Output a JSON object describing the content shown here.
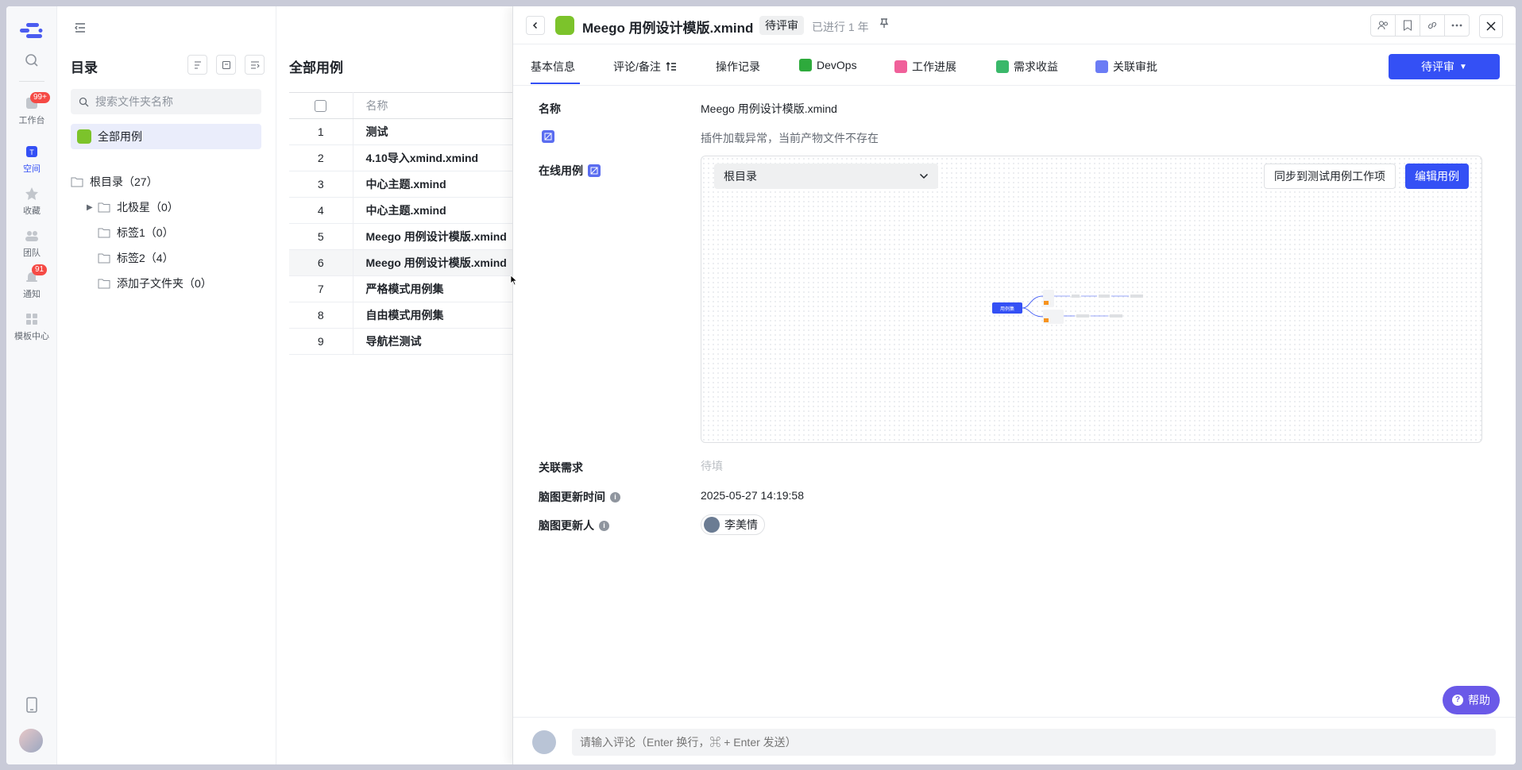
{
  "rail": {
    "items": [
      {
        "icon": "search-icon",
        "label": ""
      },
      {
        "icon": "workbench-icon",
        "label": "工作台",
        "badge": "99+"
      },
      {
        "icon": "space-icon",
        "label": "空间",
        "active": true
      },
      {
        "icon": "star-icon",
        "label": "收藏"
      },
      {
        "icon": "team-icon",
        "label": "团队"
      },
      {
        "icon": "bell-icon",
        "label": "通知",
        "badge": "91"
      },
      {
        "icon": "template-icon",
        "label": "模板中心"
      }
    ]
  },
  "directory": {
    "title": "目录",
    "search_placeholder": "搜索文件夹名称",
    "all_cases": "全部用例",
    "tree": [
      {
        "label": "根目录（27）"
      },
      {
        "label": "北极星（0）"
      },
      {
        "label": "标签1（0）"
      },
      {
        "label": "标签2（4）"
      },
      {
        "label": "添加子文件夹（0）"
      }
    ]
  },
  "list": {
    "title": "全部用例",
    "header_name": "名称",
    "rows": [
      {
        "num": "1",
        "name": "测试"
      },
      {
        "num": "2",
        "name": "4.10导入xmind.xmind"
      },
      {
        "num": "3",
        "name": "中心主题.xmind"
      },
      {
        "num": "4",
        "name": "中心主题.xmind"
      },
      {
        "num": "5",
        "name": "Meego 用例设计模版.xmind"
      },
      {
        "num": "6",
        "name": "Meego 用例设计模版.xmind"
      },
      {
        "num": "7",
        "name": "严格模式用例集"
      },
      {
        "num": "8",
        "name": "自由模式用例集"
      },
      {
        "num": "9",
        "name": "导航栏测试"
      }
    ]
  },
  "detail": {
    "title": "Meego 用例设计模版.xmind",
    "status": "待评审",
    "elapsed": "已进行 1 年",
    "tabs": [
      "基本信息",
      "评论/备注",
      "操作记录",
      "DevOps",
      "工作进展",
      "需求收益",
      "关联审批"
    ],
    "status_button": "待评审",
    "fields": {
      "name_label": "名称",
      "name_value": "Meego 用例设计模版.xmind",
      "plugin_error": "插件加载异常，当前产物文件不存在",
      "online_case_label": "在线用例",
      "root_select": "根目录",
      "sync_button": "同步到测试用例工作项",
      "edit_button": "编辑用例",
      "mindmap_root": "用例集",
      "related_req_label": "关联需求",
      "related_req_value": "待填",
      "mindmap_updated_label": "脑图更新时间",
      "mindmap_updated_value": "2025-05-27 14:19:58",
      "mindmap_updater_label": "脑图更新人",
      "mindmap_updater_value": "李美情"
    },
    "comment_placeholder": "请输入评论（Enter 换行，⌘ + Enter 发送）",
    "help": "帮助"
  },
  "colors": {
    "accent": "#3450f5",
    "badge": "#f54a45",
    "help": "#6a59e8"
  }
}
